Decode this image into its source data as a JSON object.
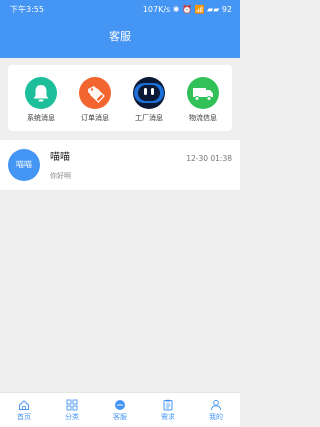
{
  "status_bar": {
    "time": "下午3:55",
    "indicators": "107K/s ✱ ⏰ 📶 ▰▰ 92"
  },
  "header": {
    "title": "客服"
  },
  "categories": [
    {
      "label": "系统消息",
      "icon": "bell-icon",
      "color": "#1dbf9b"
    },
    {
      "label": "订单消息",
      "icon": "tags-icon",
      "color": "#f2652e"
    },
    {
      "label": "工厂消息",
      "icon": "robot-face-icon",
      "color": "#0b1935"
    },
    {
      "label": "物流信息",
      "icon": "truck-icon",
      "color": "#31c158"
    }
  ],
  "conversations": [
    {
      "avatar_text": "喵喵",
      "name": "喵喵",
      "time": "12-30 01:38",
      "preview": "你好啊"
    }
  ],
  "tabbar": {
    "items": [
      {
        "label": "首页",
        "icon": "home-icon"
      },
      {
        "label": "分类",
        "icon": "grid-icon"
      },
      {
        "label": "客服",
        "icon": "chat-icon",
        "active": true
      },
      {
        "label": "需求",
        "icon": "clipboard-icon"
      },
      {
        "label": "我的",
        "icon": "user-icon"
      }
    ],
    "color": "#4595f4"
  }
}
